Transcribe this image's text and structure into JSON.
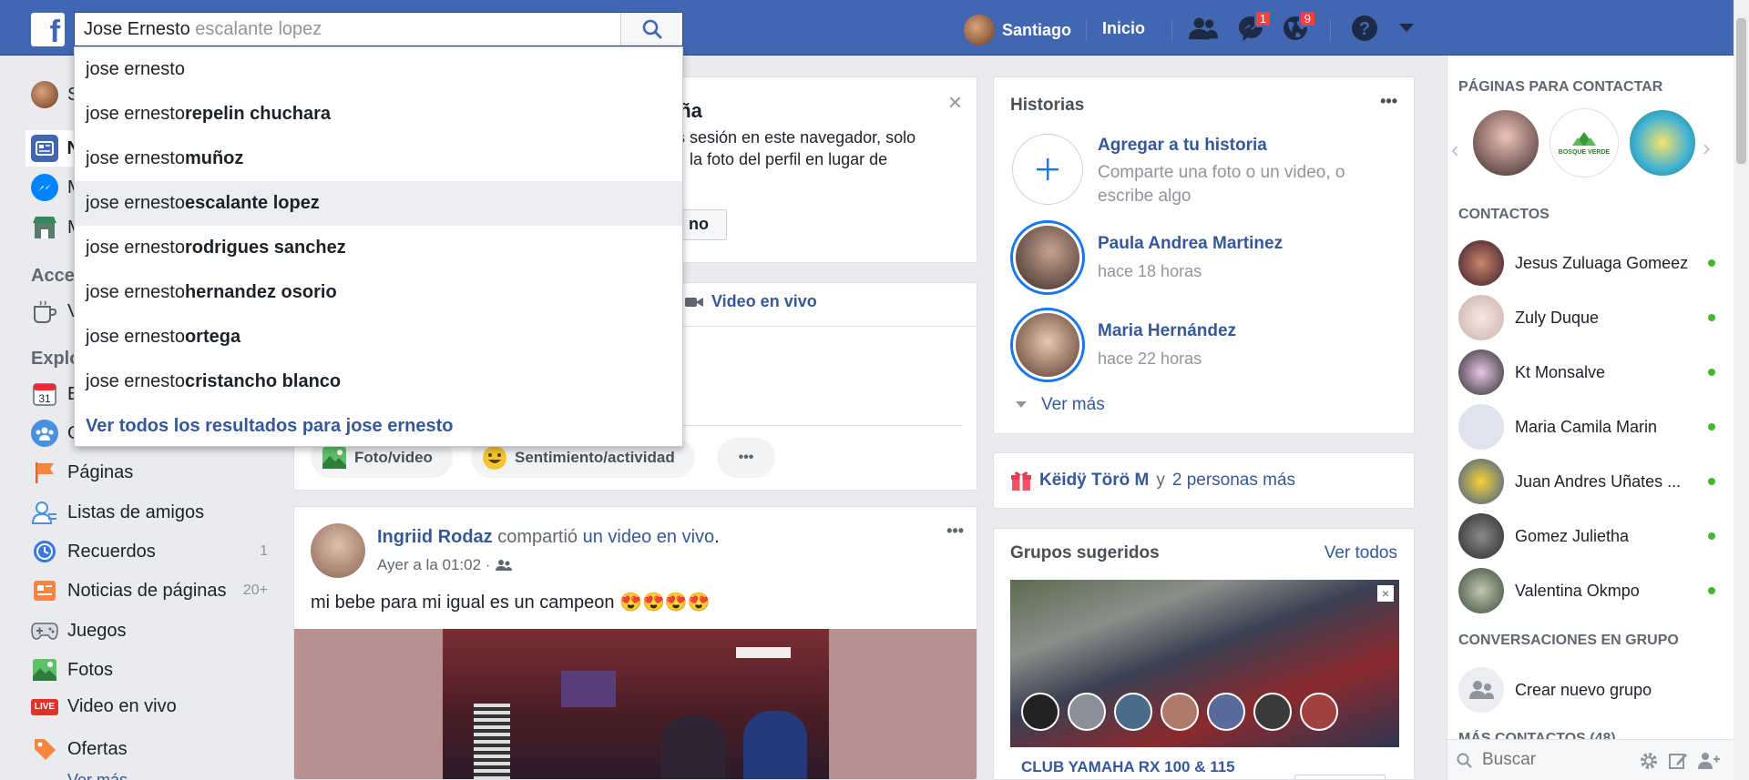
{
  "header": {
    "logo_letter": "f",
    "search_value": "Jose Ernesto",
    "search_ghost": " escalante lopez",
    "user_name": "Santiago",
    "home_label": "Inicio",
    "messages_badge": "1",
    "notifications_badge": "9"
  },
  "search_suggestions": {
    "items": [
      {
        "prefix": "jose ernesto",
        "bold": ""
      },
      {
        "prefix": "jose ernesto ",
        "bold": "repelin chuchara"
      },
      {
        "prefix": "jose ernesto ",
        "bold": "muñoz"
      },
      {
        "prefix": "jose ernesto ",
        "bold": "escalante lopez"
      },
      {
        "prefix": "jose ernesto ",
        "bold": "rodrigues sanchez"
      },
      {
        "prefix": "jose ernesto ",
        "bold": "hernandez osorio"
      },
      {
        "prefix": "jose ernesto ",
        "bold": "ortega"
      },
      {
        "prefix": "jose ernesto ",
        "bold": "cristancho blanco"
      }
    ],
    "view_all": "Ver todos los resultados para jose ernesto"
  },
  "left_nav": {
    "section_access": "Acce",
    "section_explore": "Explo",
    "partial_items": [
      "S",
      "N",
      "M",
      "M",
      "V",
      "E",
      "G"
    ],
    "items": [
      {
        "label": "Páginas",
        "count": ""
      },
      {
        "label": "Listas de amigos",
        "count": ""
      },
      {
        "label": "Recuerdos",
        "count": "1"
      },
      {
        "label": "Noticias de páginas",
        "count": "20+"
      },
      {
        "label": "Juegos",
        "count": ""
      },
      {
        "label": "Fotos",
        "count": ""
      },
      {
        "label": "Video en vivo",
        "count": ""
      },
      {
        "label": "Ofertas",
        "count": ""
      }
    ],
    "see_more": "Ver más",
    "calendar_day": "31",
    "live_icon_text": "LIVE"
  },
  "password_card": {
    "title_fragment": "eña",
    "body_line1": "es sesión en este navegador, solo",
    "body_line2": "la foto del perfil en lugar de",
    "button_fragment": "no"
  },
  "composer": {
    "live_label": "Video en vivo",
    "photo_label": "Foto/video",
    "feeling_label": "Sentimiento/actividad",
    "more_label": "•••"
  },
  "post": {
    "author": "Ingriid Rodaz",
    "action_pre": " compartió ",
    "action_link": "un video en vivo",
    "action_post": ".",
    "time": "Ayer a la 01:02 ·",
    "text": "mi bebe para mi igual es un campeon 😍😍😍😍",
    "menu": "•••"
  },
  "stories": {
    "title": "Historias",
    "menu": "•••",
    "add_title": "Agregar a tu historia",
    "add_desc_1": "Comparte una foto o un video, o",
    "add_desc_2": "escribe algo",
    "items": [
      {
        "name": "Paula Andrea Martinez",
        "time": "hace 18 horas"
      },
      {
        "name": "Maria Hernández",
        "time": "hace 22 horas"
      }
    ],
    "see_more": "Ver más"
  },
  "birthday": {
    "name": "Këidÿ Törö M",
    "and": " y ",
    "others": "2 personas más"
  },
  "groups": {
    "title": "Grupos sugeridos",
    "see_all": "Ver todos",
    "group_name": "CLUB YAMAHA RX 100 & 115"
  },
  "right_sidebar": {
    "pages_title": "PÁGINAS PARA CONTACTAR",
    "page_logo_text": "BOSQUE VERDE",
    "contacts_title": "CONTACTOS",
    "contacts": [
      {
        "name": "Jesus Zuluaga Gomeez"
      },
      {
        "name": "Zuly Duque"
      },
      {
        "name": "Kt Monsalve"
      },
      {
        "name": "Maria Camila Marin"
      },
      {
        "name": "Juan Andres Uñates ..."
      },
      {
        "name": "Gomez Julietha"
      },
      {
        "name": "Valentina Okmpo"
      }
    ],
    "group_conv_title": "CONVERSACIONES EN GRUPO",
    "create_group": "Crear nuevo grupo",
    "more_contacts": "MÁS CONTACTOS (48)",
    "search_placeholder": "Buscar"
  },
  "colors": {
    "brand": "#4267b2",
    "link": "#365899",
    "online": "#42b72a",
    "badge": "#fa3e3e"
  }
}
